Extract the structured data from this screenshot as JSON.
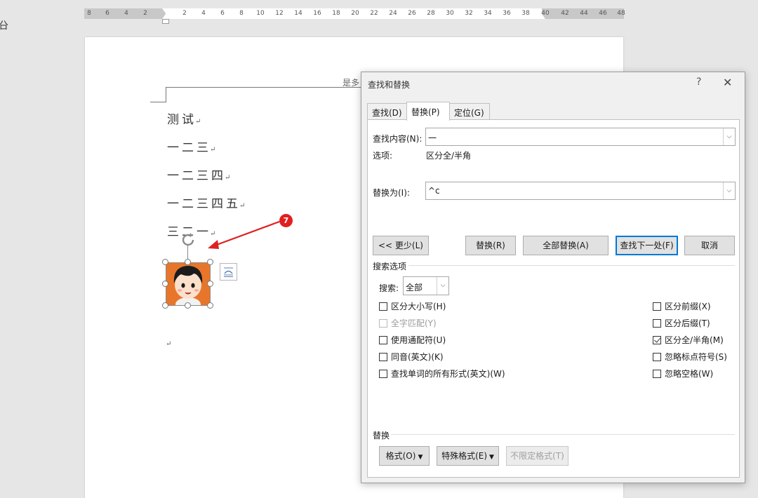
{
  "ruler": {
    "numbers": [
      "8",
      "6",
      "4",
      "2",
      "2",
      "4",
      "6",
      "8",
      "10",
      "12",
      "14",
      "16",
      "18",
      "20",
      "22",
      "24",
      "26",
      "28",
      "30",
      "32",
      "34",
      "36",
      "38",
      "40",
      "42",
      "44",
      "46",
      "48"
    ]
  },
  "page": {
    "header_text": "是多",
    "lines": [
      "测试",
      "一二三",
      "一二三四",
      "一二三四五",
      "三二一"
    ],
    "paragraph_mark": "↵"
  },
  "annotation": {
    "badge": "7",
    "color": "#e02020"
  },
  "dialog": {
    "title": "查找和替换",
    "help": "?",
    "close": "✕",
    "tabs": [
      {
        "label": "查找(D)"
      },
      {
        "label": "替换(P)"
      },
      {
        "label": "定位(G)"
      }
    ],
    "find_label": "查找内容(N):",
    "find_value": "一",
    "options_label": "选项:",
    "options_value": "区分全/半角",
    "replace_label": "替换为(I):",
    "replace_value": "^c",
    "buttons": {
      "less": "<< 更少(L)",
      "replace": "替换(R)",
      "replace_all": "全部替换(A)",
      "find_next": "查找下一处(F)",
      "cancel": "取消"
    },
    "search_options_title": "搜索选项",
    "search_label": "搜索:",
    "search_value": "全部",
    "checkboxes_left": [
      {
        "label": "区分大小写(H)",
        "checked": false,
        "disabled": false
      },
      {
        "label": "全字匹配(Y)",
        "checked": false,
        "disabled": true
      },
      {
        "label": "使用通配符(U)",
        "checked": false,
        "disabled": false
      },
      {
        "label": "同音(英文)(K)",
        "checked": false,
        "disabled": false
      },
      {
        "label": "查找单词的所有形式(英文)(W)",
        "checked": false,
        "disabled": false
      }
    ],
    "checkboxes_right": [
      {
        "label": "区分前缀(X)",
        "checked": false,
        "disabled": false
      },
      {
        "label": "区分后缀(T)",
        "checked": false,
        "disabled": false
      },
      {
        "label": "区分全/半角(M)",
        "checked": true,
        "disabled": false
      },
      {
        "label": "忽略标点符号(S)",
        "checked": false,
        "disabled": false
      },
      {
        "label": "忽略空格(W)",
        "checked": false,
        "disabled": false
      }
    ],
    "replace_section_title": "替换",
    "format_buttons": {
      "format": "格式(O)",
      "special": "特殊格式(E)",
      "no_format": "不限定格式(T)"
    },
    "accent_color": "#0078d7"
  }
}
